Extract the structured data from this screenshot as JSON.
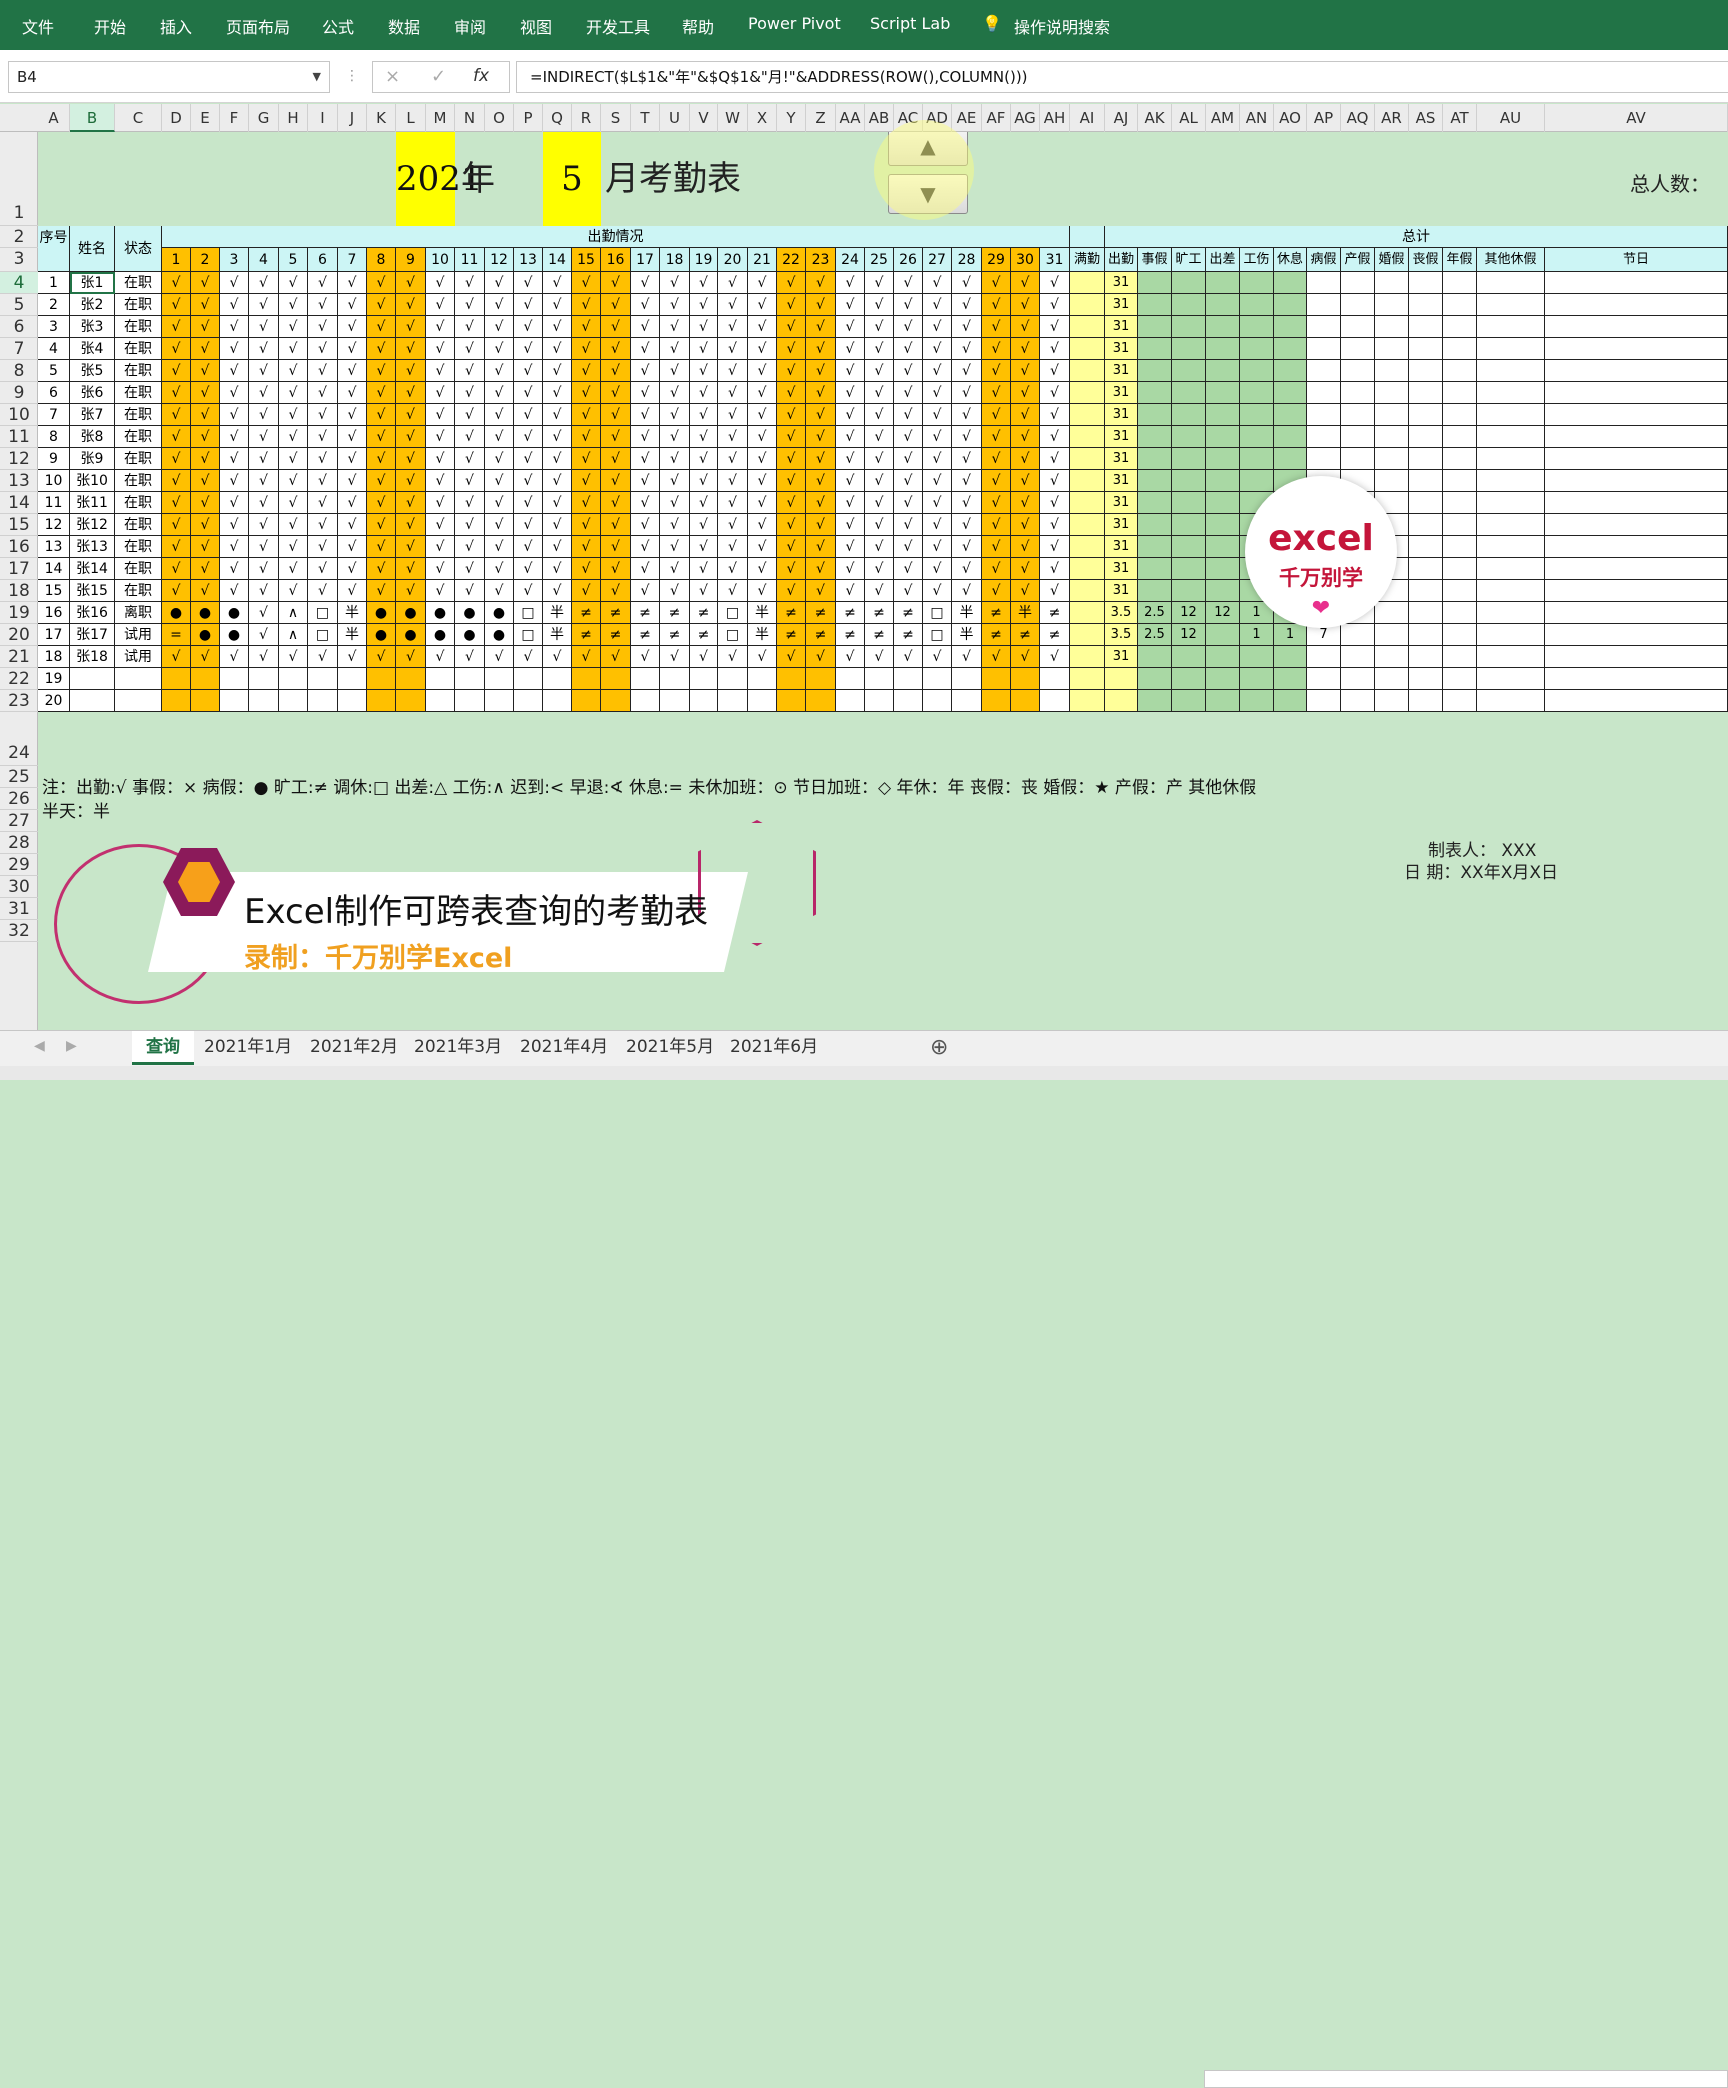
{
  "ribbon": {
    "tabs": [
      "文件",
      "开始",
      "插入",
      "页面布局",
      "公式",
      "数据",
      "审阅",
      "视图",
      "开发工具",
      "帮助",
      "Power Pivot",
      "Script Lab"
    ],
    "search": "操作说明搜索"
  },
  "formula_bar": {
    "name_box": "B4",
    "cancel_icon": "×",
    "enter_icon": "✓",
    "fx": "fx",
    "formula": "=INDIRECT($L$1&\"年\"&$Q$1&\"月!\"&ADDRESS(ROW(),COLUMN()))"
  },
  "columns": [
    "A",
    "B",
    "C",
    "D",
    "E",
    "F",
    "G",
    "H",
    "I",
    "J",
    "K",
    "L",
    "M",
    "N",
    "O",
    "P",
    "Q",
    "R",
    "S",
    "T",
    "U",
    "V",
    "W",
    "X",
    "Y",
    "Z",
    "AA",
    "AB",
    "AC",
    "AD",
    "AE",
    "AF",
    "AG",
    "AH",
    "AI",
    "AJ",
    "AK",
    "AL",
    "AM",
    "AN",
    "AO",
    "AP",
    "AQ",
    "AR",
    "AS",
    "AT",
    "AU",
    "AV"
  ],
  "selected_col": "B",
  "rows": [
    "1",
    "2",
    "3",
    "4",
    "5",
    "6",
    "7",
    "8",
    "9",
    "10",
    "11",
    "12",
    "13",
    "14",
    "15",
    "16",
    "17",
    "18",
    "19",
    "20",
    "21",
    "22",
    "23",
    "24",
    "25",
    "26",
    "27",
    "28",
    "29",
    "30",
    "31",
    "32"
  ],
  "selected_row": "4",
  "sheet": {
    "year": "2021",
    "year_label": "年",
    "month": "5",
    "month_label": "月考勤表",
    "total_people_label": "总人数：",
    "spin_up": "▲",
    "spin_down": "▼",
    "col_headers": {
      "seq": "序号",
      "name": "姓名",
      "status": "状态",
      "attendance": "出勤情况",
      "full_attendance": "满勤",
      "total": "总计"
    },
    "days": [
      "1",
      "2",
      "3",
      "4",
      "5",
      "6",
      "7",
      "8",
      "9",
      "10",
      "11",
      "12",
      "13",
      "14",
      "15",
      "16",
      "17",
      "18",
      "19",
      "20",
      "21",
      "22",
      "23",
      "24",
      "25",
      "26",
      "27",
      "28",
      "29",
      "30",
      "31"
    ],
    "weekend_days": [
      1,
      2,
      8,
      9,
      15,
      16,
      22,
      23,
      29,
      30
    ],
    "summary_headers": [
      "出勤",
      "事假",
      "旷工",
      "出差",
      "工伤",
      "休息",
      "病假",
      "产假",
      "婚假",
      "丧假",
      "年假",
      "其他休假",
      "节日"
    ],
    "employees": [
      {
        "seq": "1",
        "name": "张1",
        "status": "在职",
        "days": "all_present",
        "s": [
          "31",
          "",
          "",
          "",
          "",
          "",
          "",
          "",
          "",
          "",
          "",
          "",
          ""
        ]
      },
      {
        "seq": "2",
        "name": "张2",
        "status": "在职",
        "days": "all_present",
        "s": [
          "31",
          "",
          "",
          "",
          "",
          "",
          "",
          "",
          "",
          "",
          "",
          "",
          ""
        ]
      },
      {
        "seq": "3",
        "name": "张3",
        "status": "在职",
        "days": "all_present",
        "s": [
          "31",
          "",
          "",
          "",
          "",
          "",
          "",
          "",
          "",
          "",
          "",
          "",
          ""
        ]
      },
      {
        "seq": "4",
        "name": "张4",
        "status": "在职",
        "days": "all_present",
        "s": [
          "31",
          "",
          "",
          "",
          "",
          "",
          "",
          "",
          "",
          "",
          "",
          "",
          ""
        ]
      },
      {
        "seq": "5",
        "name": "张5",
        "status": "在职",
        "days": "all_present",
        "s": [
          "31",
          "",
          "",
          "",
          "",
          "",
          "",
          "",
          "",
          "",
          "",
          "",
          ""
        ]
      },
      {
        "seq": "6",
        "name": "张6",
        "status": "在职",
        "days": "all_present",
        "s": [
          "31",
          "",
          "",
          "",
          "",
          "",
          "",
          "",
          "",
          "",
          "",
          "",
          ""
        ]
      },
      {
        "seq": "7",
        "name": "张7",
        "status": "在职",
        "days": "all_present",
        "s": [
          "31",
          "",
          "",
          "",
          "",
          "",
          "",
          "",
          "",
          "",
          "",
          "",
          ""
        ]
      },
      {
        "seq": "8",
        "name": "张8",
        "status": "在职",
        "days": "all_present",
        "s": [
          "31",
          "",
          "",
          "",
          "",
          "",
          "",
          "",
          "",
          "",
          "",
          "",
          ""
        ]
      },
      {
        "seq": "9",
        "name": "张9",
        "status": "在职",
        "days": "all_present",
        "s": [
          "31",
          "",
          "",
          "",
          "",
          "",
          "",
          "",
          "",
          "",
          "",
          "",
          ""
        ]
      },
      {
        "seq": "10",
        "name": "张10",
        "status": "在职",
        "days": "all_present",
        "s": [
          "31",
          "",
          "",
          "",
          "",
          "",
          "",
          "",
          "",
          "",
          "",
          "",
          ""
        ]
      },
      {
        "seq": "11",
        "name": "张11",
        "status": "在职",
        "days": "all_present",
        "s": [
          "31",
          "",
          "",
          "",
          "",
          "",
          "",
          "",
          "",
          "",
          "",
          "",
          ""
        ]
      },
      {
        "seq": "12",
        "name": "张12",
        "status": "在职",
        "days": "all_present",
        "s": [
          "31",
          "",
          "",
          "",
          "",
          "",
          "",
          "",
          "",
          "",
          "",
          "",
          ""
        ]
      },
      {
        "seq": "13",
        "name": "张13",
        "status": "在职",
        "days": "all_present",
        "s": [
          "31",
          "",
          "",
          "",
          "",
          "",
          "",
          "",
          "",
          "",
          "",
          "",
          ""
        ]
      },
      {
        "seq": "14",
        "name": "张14",
        "status": "在职",
        "days": "all_present",
        "s": [
          "31",
          "",
          "",
          "",
          "",
          "",
          "",
          "",
          "",
          "",
          "",
          "",
          ""
        ]
      },
      {
        "seq": "15",
        "name": "张15",
        "status": "在职",
        "days": "all_present",
        "s": [
          "31",
          "",
          "",
          "",
          "",
          "",
          "",
          "",
          "",
          "",
          "",
          "",
          ""
        ]
      },
      {
        "seq": "16",
        "name": "张16",
        "status": "离职",
        "days": [
          "●",
          "●",
          "●",
          "√",
          "∧",
          "□",
          "半",
          "●",
          "●",
          "●",
          "●",
          "●",
          "□",
          "半",
          "≠",
          "≠",
          "≠",
          "≠",
          "≠",
          "□",
          "半",
          "≠",
          "≠",
          "≠",
          "≠",
          "≠",
          "□",
          "半",
          "≠",
          "半",
          "≠"
        ],
        "s": [
          "3.5",
          "2.5",
          "12",
          "12",
          "1",
          "",
          "8",
          "",
          "",
          "",
          "",
          "",
          ""
        ]
      },
      {
        "seq": "17",
        "name": "张17",
        "status": "试用",
        "days": [
          "=",
          "●",
          "●",
          "√",
          "∧",
          "□",
          "半",
          "●",
          "●",
          "●",
          "●",
          "●",
          "□",
          "半",
          "≠",
          "≠",
          "≠",
          "≠",
          "≠",
          "□",
          "半",
          "≠",
          "≠",
          "≠",
          "≠",
          "≠",
          "□",
          "半",
          "≠",
          "≠",
          "≠"
        ],
        "s": [
          "3.5",
          "2.5",
          "12",
          "",
          "1",
          "1",
          "7",
          "",
          "",
          "",
          "",
          "",
          ""
        ]
      },
      {
        "seq": "18",
        "name": "张18",
        "status": "试用",
        "days": "all_present",
        "s": [
          "31",
          "",
          "",
          "",
          "",
          "",
          "",
          "",
          "",
          "",
          "",
          "",
          ""
        ]
      },
      {
        "seq": "19",
        "name": "",
        "status": "",
        "days": "empty",
        "s": [
          "",
          "",
          "",
          "",
          "",
          "",
          "",
          "",
          "",
          "",
          "",
          "",
          ""
        ]
      },
      {
        "seq": "20",
        "name": "",
        "status": "",
        "days": "empty",
        "s": [
          "",
          "",
          "",
          "",
          "",
          "",
          "",
          "",
          "",
          "",
          "",
          "",
          ""
        ]
      }
    ],
    "present_mark": "√",
    "legend_line1": "注：出勤:√   事假：×  病假：●  旷工:≠    调休:□    出差:△    工伤:∧    迟到:<    早退:∢    休息:=      未休加班：⊙    节日加班：◇    年休：年    丧假：丧    婚假：★    产假：产      其他休假",
    "legend_line2": "半天：半",
    "maker_label": "制表人：   XXX",
    "date_label": "日   期：XX年X月X日"
  },
  "overlay": {
    "stamp_title": "excel",
    "stamp_sub": "千万别学",
    "stamp_heart": "❤",
    "banner_title": "Excel制作可跨表查询的考勤表",
    "banner_sub": "录制：千万别学Excel"
  },
  "sheet_tabs": [
    "查询",
    "2021年1月",
    "2021年2月",
    "2021年3月",
    "2021年4月",
    "2021年5月",
    "2021年6月"
  ],
  "active_tab": "查询",
  "add_sheet": "⊕",
  "colors": {
    "ribbon": "#217346",
    "sheet_bg": "#c8e6c9",
    "weekend": "#ffc000",
    "header_cyan": "#ccf5f5",
    "yellow": "#ffff00",
    "full_col": "#ffff99",
    "summary_green": "#a9d8a4"
  }
}
